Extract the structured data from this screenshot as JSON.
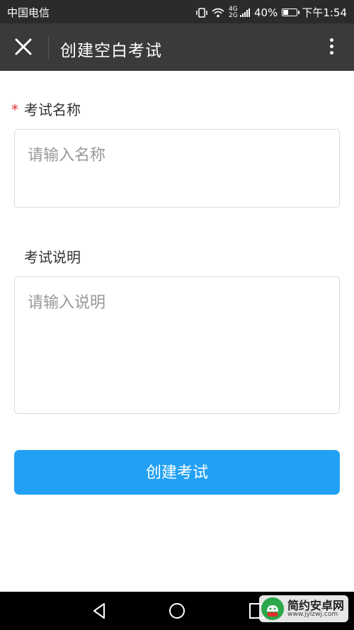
{
  "status_bar": {
    "carrier": "中国电信",
    "network_type_top": "4G",
    "network_type_bottom": "2G",
    "battery_percent": "40%",
    "battery_level": 0.4,
    "time": "下午1:54"
  },
  "header": {
    "title": "创建空白考试",
    "close_icon": "close-icon",
    "menu_icon": "more-vertical-icon"
  },
  "form": {
    "name_label": "考试名称",
    "required_mark": "*",
    "name_placeholder": "请输入名称",
    "name_value": "",
    "desc_label": "考试说明",
    "desc_placeholder": "请输入说明",
    "desc_value": "",
    "submit_label": "创建考试"
  },
  "nav_bar": {
    "icons": [
      "back-icon",
      "home-icon",
      "recents-icon"
    ]
  },
  "watermark": {
    "name": "简约安卓网",
    "url": "www.jylzwj.com"
  },
  "colors": {
    "accent": "#22a1f4",
    "header_bg": "#3a3a3a",
    "required": "#e03030"
  }
}
